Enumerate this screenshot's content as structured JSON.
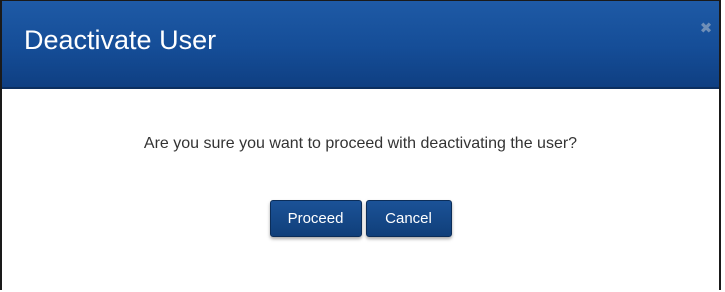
{
  "dialog": {
    "title": "Deactivate User",
    "close_glyph": "✖",
    "close_icon": "close-icon",
    "message": "Are you sure you want to proceed with deactivating the user?",
    "buttons": {
      "proceed_label": "Proceed",
      "cancel_label": "Cancel"
    }
  },
  "colors": {
    "header_bg": "#154d97",
    "button_bg": "#154a8c",
    "text": "#333333"
  }
}
